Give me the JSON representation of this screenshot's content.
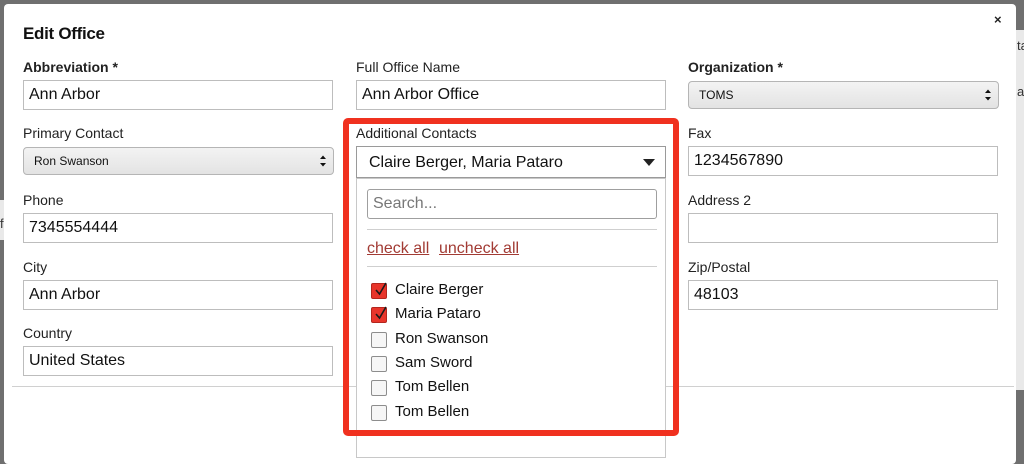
{
  "background": {
    "right_fragments": [
      "ta",
      "a"
    ],
    "left_fragment": "f"
  },
  "modal": {
    "title": "Edit Office",
    "close_label": "×"
  },
  "fields": {
    "abbreviation": {
      "label": "Abbreviation *",
      "value": "Ann Arbor"
    },
    "full_office_name": {
      "label": "Full Office Name",
      "value": "Ann Arbor Office"
    },
    "organization": {
      "label": "Organization *",
      "value": "TOMS"
    },
    "primary_contact": {
      "label": "Primary Contact",
      "value": "Ron Swanson"
    },
    "additional_contacts": {
      "label": "Additional Contacts",
      "value": "Claire Berger, Maria Pataro"
    },
    "fax": {
      "label": "Fax",
      "value": "1234567890"
    },
    "phone": {
      "label": "Phone",
      "value": "7345554444"
    },
    "address2": {
      "label": "Address 2",
      "value": ""
    },
    "city": {
      "label": "City",
      "value": "Ann Arbor"
    },
    "zip": {
      "label": "Zip/Postal",
      "value": "48103"
    },
    "country": {
      "label": "Country",
      "value": "United States"
    }
  },
  "dropdown": {
    "search_placeholder": "Search...",
    "check_all": "check all",
    "uncheck_all": "uncheck all",
    "options": [
      {
        "label": "Claire Berger",
        "checked": true
      },
      {
        "label": "Maria Pataro",
        "checked": true
      },
      {
        "label": "Ron Swanson",
        "checked": false
      },
      {
        "label": "Sam Sword",
        "checked": false
      },
      {
        "label": "Tom Bellen",
        "checked": false
      },
      {
        "label": "Tom Bellen",
        "checked": false
      }
    ]
  },
  "colors": {
    "highlight": "#f0311f",
    "checkbox_checked": "#e8352b",
    "link": "#a23b34"
  }
}
